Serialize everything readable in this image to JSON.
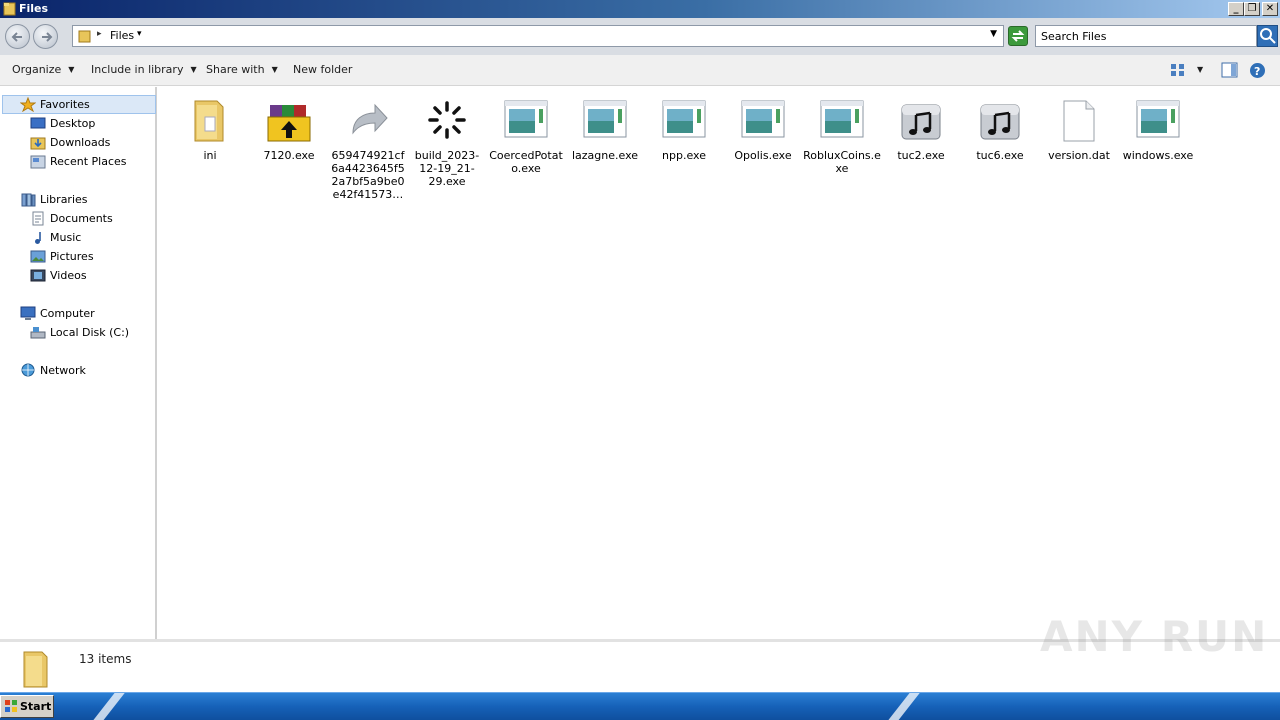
{
  "window": {
    "title": "Files"
  },
  "address": {
    "crumb": "Files"
  },
  "search": {
    "placeholder": "Search Files"
  },
  "toolbar": {
    "organize": "Organize",
    "include_in_library": "Include in library",
    "share_with": "Share with",
    "new_folder": "New folder"
  },
  "sidebar": {
    "favorites": {
      "label": "Favorites",
      "items": [
        "Desktop",
        "Downloads",
        "Recent Places"
      ]
    },
    "libraries": {
      "label": "Libraries",
      "items": [
        "Documents",
        "Music",
        "Pictures",
        "Videos"
      ]
    },
    "computer": {
      "label": "Computer",
      "items": [
        "Local Disk (C:)"
      ]
    },
    "network": {
      "label": "Network"
    }
  },
  "files": [
    {
      "name": "ini",
      "icon": "folder-icon"
    },
    {
      "name": "7120.exe",
      "icon": "winrar-sfx-icon"
    },
    {
      "name": "659474921cf6a4423645f52a7bf5a9be0e42f41573…",
      "icon": "shortcut-arrow-icon"
    },
    {
      "name": "build_2023-12-19_21-29.exe",
      "icon": "loading-spinner-icon"
    },
    {
      "name": "CoercedPotato.exe",
      "icon": "application-window-icon"
    },
    {
      "name": "lazagne.exe",
      "icon": "application-window-icon"
    },
    {
      "name": "npp.exe",
      "icon": "application-window-icon"
    },
    {
      "name": "Opolis.exe",
      "icon": "application-window-icon"
    },
    {
      "name": "RobluxCoins.exe",
      "icon": "application-window-icon"
    },
    {
      "name": "tuc2.exe",
      "icon": "music-file-icon"
    },
    {
      "name": "tuc6.exe",
      "icon": "music-file-icon"
    },
    {
      "name": "version.dat",
      "icon": "blank-file-icon"
    },
    {
      "name": "windows.exe",
      "icon": "application-window-icon"
    }
  ],
  "status": {
    "item_count": "13 items"
  },
  "taskbar": {
    "start_label": "Start"
  },
  "watermark": "ANY RUN"
}
